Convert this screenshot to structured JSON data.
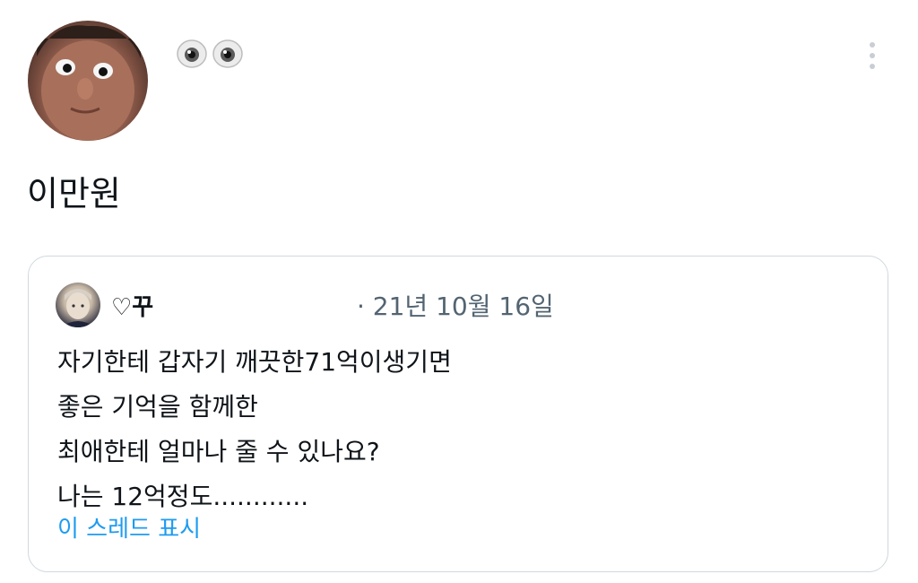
{
  "tweet": {
    "display_name_icons": [
      "eye-icon",
      "eye-icon"
    ],
    "text": "이만원"
  },
  "quoted_tweet": {
    "author_name": "♡꾸",
    "date": "· 21년 10월 16일",
    "lines": [
      "자기한테 갑자기 깨끗한71억이생기면",
      "좋은 기억을 함께한",
      "최애한테 얼마나 줄 수 있나요?",
      "나는 12억정도............"
    ],
    "show_thread_label": "이 스레드 표시"
  },
  "colors": {
    "text_primary": "#0f1419",
    "text_secondary": "#536471",
    "link": "#1d9bf0",
    "border": "#cfd9de",
    "menu_dots": "#c8ced3"
  }
}
